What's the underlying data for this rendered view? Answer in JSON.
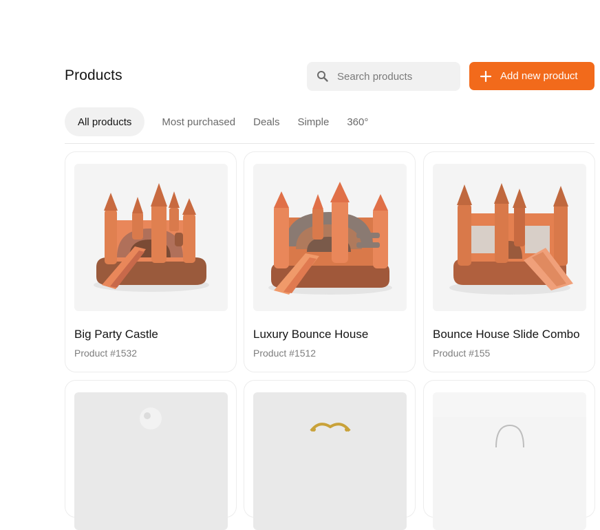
{
  "header": {
    "title": "Products",
    "search_placeholder": "Search products",
    "add_label": "Add new product"
  },
  "tabs": [
    {
      "label": "All products",
      "active": true
    },
    {
      "label": "Most purchased",
      "active": false
    },
    {
      "label": "Deals",
      "active": false
    },
    {
      "label": "Simple",
      "active": false
    },
    {
      "label": "360°",
      "active": false
    }
  ],
  "products": [
    {
      "name": "Big Party Castle",
      "sku": "Product #1532"
    },
    {
      "name": "Luxury Bounce House",
      "sku": "Product #1512"
    },
    {
      "name": "Bounce House Slide Combo",
      "sku": "Product #155"
    }
  ],
  "colors": {
    "accent": "#f26a1b",
    "inflatable_orange": "#e9875a",
    "inflatable_brown": "#9a5a3c",
    "inflatable_gray": "#8a7a72"
  },
  "icons": {
    "search": "search-icon",
    "plus": "plus-icon"
  }
}
